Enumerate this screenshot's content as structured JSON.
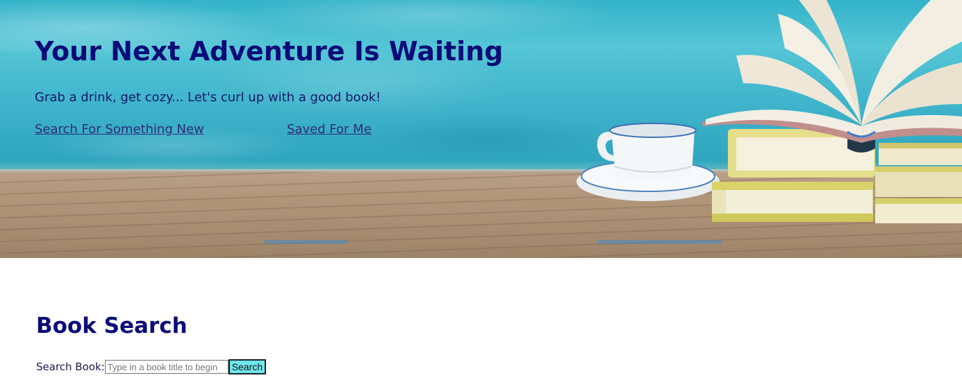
{
  "hero": {
    "title": "Your Next Adventure Is Waiting",
    "tagline": "Grab a drink, get cozy... Let's curl up with a good book!",
    "nav": {
      "search_link": "Search For Something New",
      "saved_link": "Saved For Me"
    }
  },
  "search": {
    "heading": "Book Search",
    "label": "Search Book:",
    "placeholder": "Type in a book title to begin",
    "value": "",
    "button_label": "Search"
  },
  "colors": {
    "heading": "#0b0b78",
    "link": "#2e2a7a",
    "button_bg": "#6ee8ee"
  }
}
